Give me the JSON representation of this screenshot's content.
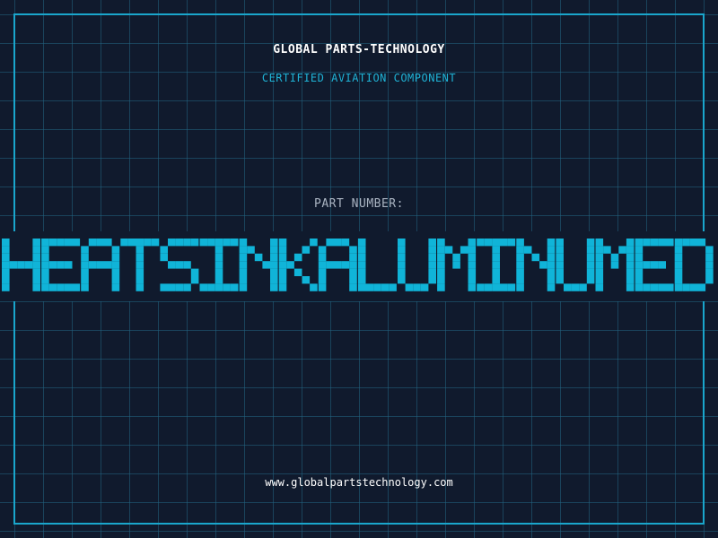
{
  "header": {
    "company": "GLOBAL PARTS-TECHNOLOGY",
    "subtitle": "CERTIFIED AVIATION COMPONENT"
  },
  "part": {
    "label": "PART NUMBER:",
    "number": "HEATSINKALUMINUMED"
  },
  "footer": {
    "website": "www.globalpartstechnology.com"
  },
  "colors": {
    "background": "#101a2d",
    "accent": "#1aa6cc",
    "part_number": "#10b4d8"
  }
}
